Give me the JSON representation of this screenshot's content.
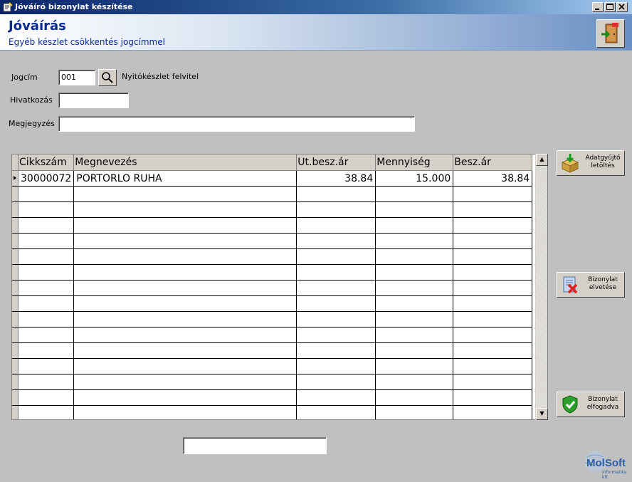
{
  "window": {
    "title": "Jóváíró bizonylat készítése"
  },
  "header": {
    "title": "Jóváírás",
    "subtitle": "Egyéb készlet csökkentés jogcímmel"
  },
  "form": {
    "jogcim_label": "Jogcím",
    "jogcim_value": "001",
    "jogcim_desc": "Nyitókészlet felvitel",
    "hivatkozas_label": "Hivatkozás",
    "hivatkozas_value": "",
    "megjegyzes_label": "Megjegyzés",
    "megjegyzes_value": ""
  },
  "grid": {
    "columns": [
      "Cikkszám",
      "Megnevezés",
      "Ut.besz.ár",
      "Mennyiség",
      "Besz.ár"
    ],
    "rows": [
      {
        "cikkszam": "30000072",
        "megnevezes": "PORTORLO RUHA",
        "ut_besz_ar": "38.84",
        "mennyiseg": "15.000",
        "besz_ar": "38.84"
      }
    ]
  },
  "buttons": {
    "download": "Adatgyűjtő letöltés",
    "reject": "Bizonylat elvetése",
    "accept": "Bizonylat elfogadva"
  },
  "footer": {
    "status_value": ""
  },
  "logo": {
    "text": "MolSoft",
    "sub": "Informatika kft."
  },
  "colors": {
    "title_blue": "#0a2a8c",
    "titlebar": "#0a246a"
  },
  "icons": [
    "app-icon",
    "minimize-icon",
    "maximize-icon",
    "close-icon",
    "exit-door-icon",
    "search-icon",
    "download-box-icon",
    "reject-document-icon",
    "accept-shield-icon"
  ]
}
